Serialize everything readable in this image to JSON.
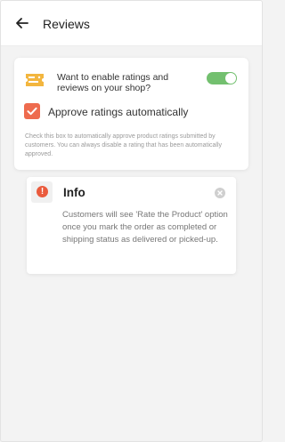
{
  "header": {
    "title": "Reviews",
    "back_icon": "arrow-left-icon"
  },
  "ratings_card": {
    "icon": "ticket-icon",
    "enable_label": "Want to enable ratings and reviews on your shop?",
    "enable_toggle_on": true,
    "approve_checked": true,
    "approve_label": "Approve ratings automatically",
    "helper_text": "Check this box to automatically approve product ratings submitted by customers. You can always disable a rating that has been automatically approved."
  },
  "info_card": {
    "icon": "alert-icon",
    "icon_glyph": "!",
    "title": "Info",
    "close_icon": "close-icon",
    "body": "Customers will see 'Rate the Product' option once you mark the order as completed or shipping status as delivered or picked-up."
  },
  "colors": {
    "toggle_on": "#73c06f",
    "checkbox": "#ee6b4e",
    "alert": "#ea5a3c",
    "ticket": "#f3b63f"
  }
}
